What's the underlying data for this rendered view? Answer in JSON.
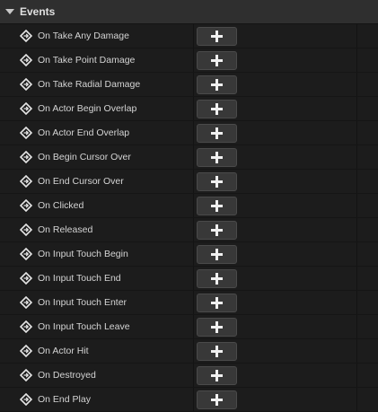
{
  "section": {
    "title": "Events"
  },
  "events": [
    {
      "label": "On Take Any Damage"
    },
    {
      "label": "On Take Point Damage"
    },
    {
      "label": "On Take Radial Damage"
    },
    {
      "label": "On Actor Begin Overlap"
    },
    {
      "label": "On Actor End Overlap"
    },
    {
      "label": "On Begin Cursor Over"
    },
    {
      "label": "On End Cursor Over"
    },
    {
      "label": "On Clicked"
    },
    {
      "label": "On Released"
    },
    {
      "label": "On Input Touch Begin"
    },
    {
      "label": "On Input Touch End"
    },
    {
      "label": "On Input Touch Enter"
    },
    {
      "label": "On Input Touch Leave"
    },
    {
      "label": "On Actor Hit"
    },
    {
      "label": "On Destroyed"
    },
    {
      "label": "On End Play"
    }
  ],
  "icons": {
    "section_toggle": "collapse-triangle-icon",
    "event": "event-diamond-icon",
    "add": "plus-icon"
  },
  "colors": {
    "background": "#1b1b1b",
    "header": "#2f2f2f",
    "button": "#383838",
    "text": "#d4d4d4"
  }
}
